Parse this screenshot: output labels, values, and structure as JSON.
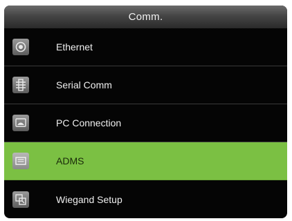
{
  "header": {
    "title": "Comm."
  },
  "menu": {
    "items": [
      {
        "label": "Ethernet",
        "icon": "ethernet-icon",
        "selected": false
      },
      {
        "label": "Serial Comm",
        "icon": "serial-comm-icon",
        "selected": false
      },
      {
        "label": "PC Connection",
        "icon": "pc-connection-icon",
        "selected": false
      },
      {
        "label": "ADMS",
        "icon": "adms-icon",
        "selected": true
      },
      {
        "label": "Wiegand Setup",
        "icon": "wiegand-setup-icon",
        "selected": false
      }
    ]
  },
  "colors": {
    "background": "#050505",
    "selected": "#7bc043",
    "text": "#f0f0f0"
  }
}
